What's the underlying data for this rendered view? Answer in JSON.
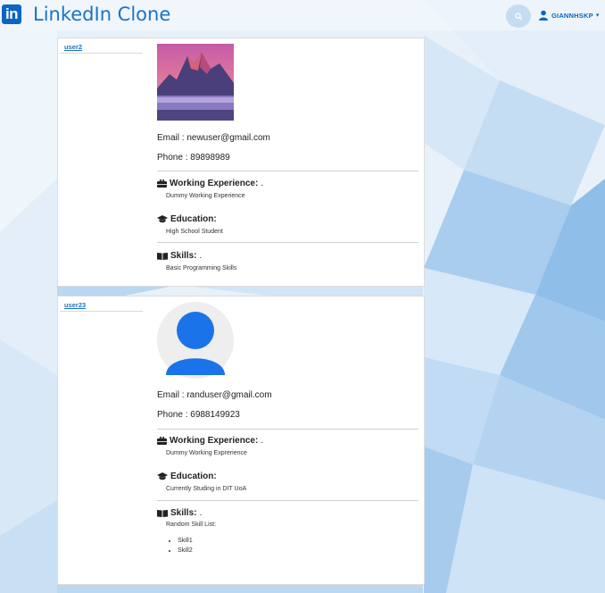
{
  "app": {
    "logo_text": "in",
    "title": "LinkedIn Clone",
    "user_name": "GIANNHSKP",
    "caret": "▾"
  },
  "profiles": [
    {
      "username": "user2",
      "email": "Email : newuser@gmail.com",
      "phone": "Phone : 89898989",
      "experience_title": "Working Experience:",
      "experience_suffix": ".",
      "experience_text": "Dummy Working Experience",
      "education_title": "Education:",
      "education_text": "High School Student",
      "skills_title": "Skills:",
      "skills_suffix": ".",
      "skills_text": "Basic Programming Skills",
      "avatar": "mountain-photo"
    },
    {
      "username": "user23",
      "email": "Email : randuser@gmail.com",
      "phone": "Phone : 6988149923",
      "experience_title": "Working Experience:",
      "experience_suffix": ".",
      "experience_text": "Dummy Working Exprerience",
      "education_title": "Education:",
      "education_text": "Currently Studing in DIT UoA",
      "skills_title": "Skills:",
      "skills_suffix": ".",
      "skills_text": "Random Skill List:",
      "skills_list": [
        "Skill1",
        "Skill2"
      ],
      "avatar": "default-person"
    }
  ],
  "colors": {
    "brand": "#0a66c2",
    "link": "#1a73c7",
    "avatar_blue": "#1a73e8"
  }
}
